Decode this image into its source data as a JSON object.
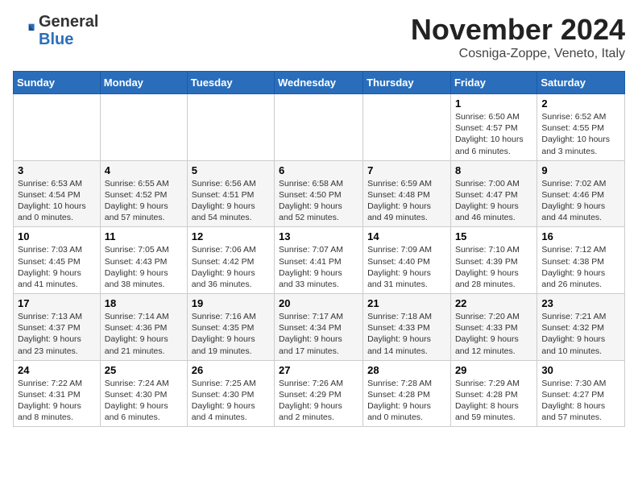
{
  "header": {
    "logo_general": "General",
    "logo_blue": "Blue",
    "month_title": "November 2024",
    "location": "Cosniga-Zoppe, Veneto, Italy"
  },
  "weekdays": [
    "Sunday",
    "Monday",
    "Tuesday",
    "Wednesday",
    "Thursday",
    "Friday",
    "Saturday"
  ],
  "weeks": [
    [
      {
        "day": "",
        "info": ""
      },
      {
        "day": "",
        "info": ""
      },
      {
        "day": "",
        "info": ""
      },
      {
        "day": "",
        "info": ""
      },
      {
        "day": "",
        "info": ""
      },
      {
        "day": "1",
        "info": "Sunrise: 6:50 AM\nSunset: 4:57 PM\nDaylight: 10 hours\nand 6 minutes."
      },
      {
        "day": "2",
        "info": "Sunrise: 6:52 AM\nSunset: 4:55 PM\nDaylight: 10 hours\nand 3 minutes."
      }
    ],
    [
      {
        "day": "3",
        "info": "Sunrise: 6:53 AM\nSunset: 4:54 PM\nDaylight: 10 hours\nand 0 minutes."
      },
      {
        "day": "4",
        "info": "Sunrise: 6:55 AM\nSunset: 4:52 PM\nDaylight: 9 hours\nand 57 minutes."
      },
      {
        "day": "5",
        "info": "Sunrise: 6:56 AM\nSunset: 4:51 PM\nDaylight: 9 hours\nand 54 minutes."
      },
      {
        "day": "6",
        "info": "Sunrise: 6:58 AM\nSunset: 4:50 PM\nDaylight: 9 hours\nand 52 minutes."
      },
      {
        "day": "7",
        "info": "Sunrise: 6:59 AM\nSunset: 4:48 PM\nDaylight: 9 hours\nand 49 minutes."
      },
      {
        "day": "8",
        "info": "Sunrise: 7:00 AM\nSunset: 4:47 PM\nDaylight: 9 hours\nand 46 minutes."
      },
      {
        "day": "9",
        "info": "Sunrise: 7:02 AM\nSunset: 4:46 PM\nDaylight: 9 hours\nand 44 minutes."
      }
    ],
    [
      {
        "day": "10",
        "info": "Sunrise: 7:03 AM\nSunset: 4:45 PM\nDaylight: 9 hours\nand 41 minutes."
      },
      {
        "day": "11",
        "info": "Sunrise: 7:05 AM\nSunset: 4:43 PM\nDaylight: 9 hours\nand 38 minutes."
      },
      {
        "day": "12",
        "info": "Sunrise: 7:06 AM\nSunset: 4:42 PM\nDaylight: 9 hours\nand 36 minutes."
      },
      {
        "day": "13",
        "info": "Sunrise: 7:07 AM\nSunset: 4:41 PM\nDaylight: 9 hours\nand 33 minutes."
      },
      {
        "day": "14",
        "info": "Sunrise: 7:09 AM\nSunset: 4:40 PM\nDaylight: 9 hours\nand 31 minutes."
      },
      {
        "day": "15",
        "info": "Sunrise: 7:10 AM\nSunset: 4:39 PM\nDaylight: 9 hours\nand 28 minutes."
      },
      {
        "day": "16",
        "info": "Sunrise: 7:12 AM\nSunset: 4:38 PM\nDaylight: 9 hours\nand 26 minutes."
      }
    ],
    [
      {
        "day": "17",
        "info": "Sunrise: 7:13 AM\nSunset: 4:37 PM\nDaylight: 9 hours\nand 23 minutes."
      },
      {
        "day": "18",
        "info": "Sunrise: 7:14 AM\nSunset: 4:36 PM\nDaylight: 9 hours\nand 21 minutes."
      },
      {
        "day": "19",
        "info": "Sunrise: 7:16 AM\nSunset: 4:35 PM\nDaylight: 9 hours\nand 19 minutes."
      },
      {
        "day": "20",
        "info": "Sunrise: 7:17 AM\nSunset: 4:34 PM\nDaylight: 9 hours\nand 17 minutes."
      },
      {
        "day": "21",
        "info": "Sunrise: 7:18 AM\nSunset: 4:33 PM\nDaylight: 9 hours\nand 14 minutes."
      },
      {
        "day": "22",
        "info": "Sunrise: 7:20 AM\nSunset: 4:33 PM\nDaylight: 9 hours\nand 12 minutes."
      },
      {
        "day": "23",
        "info": "Sunrise: 7:21 AM\nSunset: 4:32 PM\nDaylight: 9 hours\nand 10 minutes."
      }
    ],
    [
      {
        "day": "24",
        "info": "Sunrise: 7:22 AM\nSunset: 4:31 PM\nDaylight: 9 hours\nand 8 minutes."
      },
      {
        "day": "25",
        "info": "Sunrise: 7:24 AM\nSunset: 4:30 PM\nDaylight: 9 hours\nand 6 minutes."
      },
      {
        "day": "26",
        "info": "Sunrise: 7:25 AM\nSunset: 4:30 PM\nDaylight: 9 hours\nand 4 minutes."
      },
      {
        "day": "27",
        "info": "Sunrise: 7:26 AM\nSunset: 4:29 PM\nDaylight: 9 hours\nand 2 minutes."
      },
      {
        "day": "28",
        "info": "Sunrise: 7:28 AM\nSunset: 4:28 PM\nDaylight: 9 hours\nand 0 minutes."
      },
      {
        "day": "29",
        "info": "Sunrise: 7:29 AM\nSunset: 4:28 PM\nDaylight: 8 hours\nand 59 minutes."
      },
      {
        "day": "30",
        "info": "Sunrise: 7:30 AM\nSunset: 4:27 PM\nDaylight: 8 hours\nand 57 minutes."
      }
    ]
  ]
}
